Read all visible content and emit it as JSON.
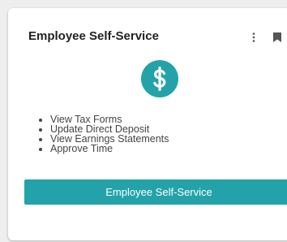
{
  "card": {
    "title": "Employee Self-Service",
    "icons": {
      "menu": "vertical-ellipsis-icon",
      "bookmark": "bookmark-icon",
      "main": "dollar-sign-icon"
    },
    "features": [
      "View Tax Forms",
      "Update Direct Deposit",
      "View Earnings Statements",
      "Approve Time"
    ],
    "button_label": "Employee Self-Service"
  },
  "colors": {
    "accent": "#23a3a9",
    "title_text": "#222222",
    "body_text": "#444444",
    "icon_gray": "#555555",
    "background": "#eeeeee",
    "card_background": "#ffffff"
  }
}
